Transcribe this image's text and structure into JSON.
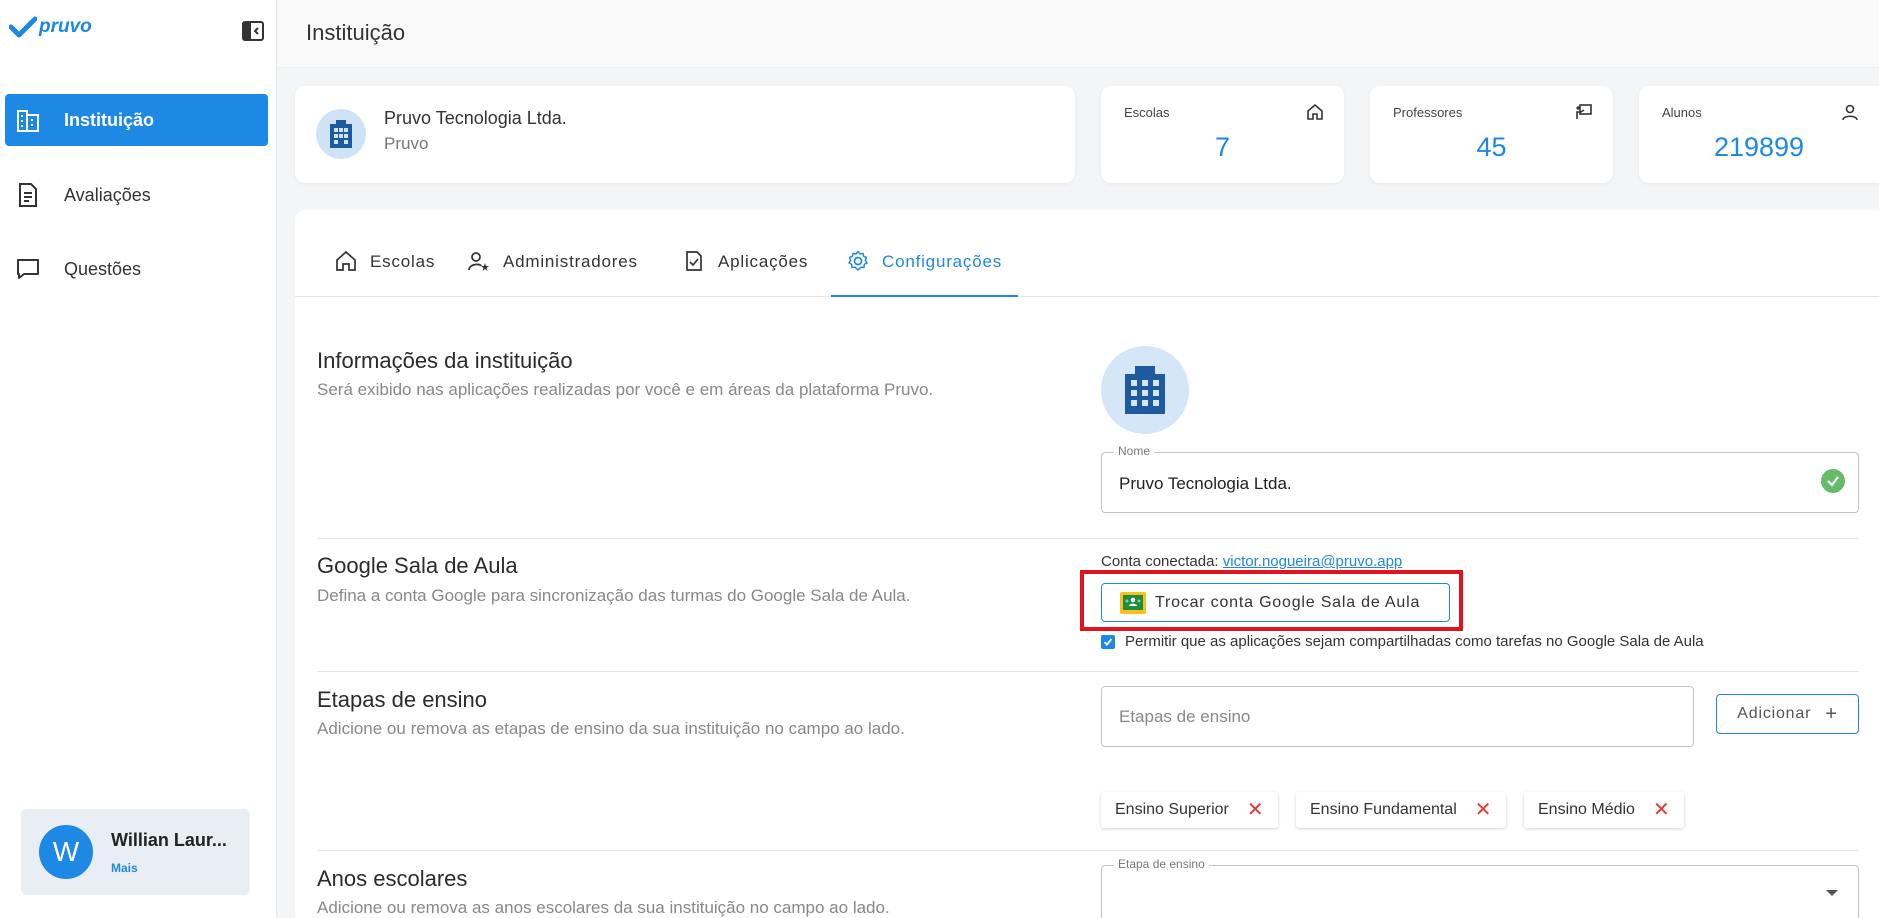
{
  "brand": {
    "name": "pruvo",
    "color": "#1e88e5"
  },
  "sidebar": {
    "items": [
      {
        "label": "Instituição",
        "icon": "building-icon",
        "active": true
      },
      {
        "label": "Avaliações",
        "icon": "document-icon",
        "active": false
      },
      {
        "label": "Questões",
        "icon": "chat-icon",
        "active": false
      }
    ],
    "user": {
      "initial": "W",
      "name": "Willian Laur...",
      "more": "Mais"
    }
  },
  "header": {
    "title": "Instituição"
  },
  "institution": {
    "name": "Pruvo Tecnologia Ltda.",
    "short": "Pruvo"
  },
  "stats": [
    {
      "label": "Escolas",
      "value": "7",
      "icon": "home-icon"
    },
    {
      "label": "Professores",
      "value": "45",
      "icon": "presentation-icon"
    },
    {
      "label": "Alunos",
      "value": "219899",
      "icon": "person-icon"
    }
  ],
  "tabs": [
    {
      "label": "Escolas",
      "icon": "home-icon",
      "active": false
    },
    {
      "label": "Administradores",
      "icon": "admin-icon",
      "active": false
    },
    {
      "label": "Aplicações",
      "icon": "checklist-icon",
      "active": false
    },
    {
      "label": "Configurações",
      "icon": "gear-icon",
      "active": true
    }
  ],
  "sections": {
    "info": {
      "title": "Informações da instituição",
      "desc": "Será exibido nas aplicações realizadas por você e em áreas da plataforma Pruvo.",
      "name_label": "Nome",
      "name_value": "Pruvo Tecnologia Ltda."
    },
    "google": {
      "title": "Google Sala de Aula",
      "desc": "Defina a conta Google para sincronização das turmas do Google Sala de Aula.",
      "connected_prefix": "Conta conectada: ",
      "connected_email": "victor.nogueira@pruvo.app",
      "switch_button": "Trocar conta Google Sala de Aula",
      "share_label": "Permitir que as aplicações sejam compartilhadas como tarefas no Google Sala de Aula",
      "share_checked": true
    },
    "stages": {
      "title": "Etapas de ensino",
      "desc": "Adicione ou remova as etapas de ensino da sua instituição no campo ao lado.",
      "placeholder": "Etapas de ensino",
      "add_button": "Adicionar",
      "chips": [
        "Ensino Superior",
        "Ensino Fundamental",
        "Ensino Médio"
      ]
    },
    "years": {
      "title": "Anos escolares",
      "desc": "Adicione ou remova as anos escolares da sua instituição no campo ao lado.",
      "select_label": "Etapa de ensino"
    }
  },
  "colors": {
    "accent": "#1e88e5",
    "success": "#66bb6a",
    "danger": "#e53935",
    "highlight": "#e0141e"
  }
}
